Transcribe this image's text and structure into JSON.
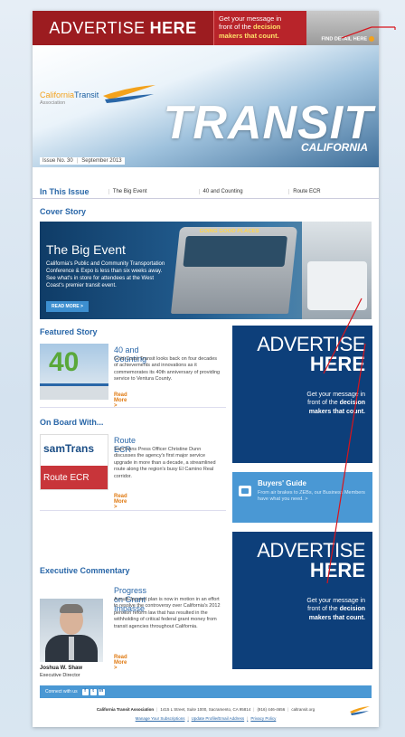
{
  "banner": {
    "advertise_word": "ADVERTISE",
    "here_word": "HERE",
    "line1": "Get your message in",
    "line2": "front of the",
    "line2_bold": "decision",
    "line3": "makers that count.",
    "find_label": "FIND DETAIL HERE"
  },
  "masthead": {
    "logo_part1": "California",
    "logo_part2": "Transit",
    "logo_assoc": "Association",
    "title": "TRANSIT",
    "subtitle": "CALIFORNIA",
    "issue": "Issue No. 30",
    "date": "September 2013"
  },
  "in_this_issue": {
    "label": "In This Issue",
    "items": [
      "The Big Event",
      "40 and Counting",
      "Route ECR"
    ]
  },
  "cover_story": {
    "heading": "Cover Story",
    "title": "The Big Event",
    "description": "California's Public and Community Transportation Conference & Expo is less than six weeks away. See what's in store for attendees at the West Coast's premier transit event.",
    "button": "READ MORE >",
    "bus_sign": "GOING GOOD PLACES"
  },
  "featured": {
    "heading": "Featured Story",
    "title": "40 and Counting",
    "text": "Gold Coast Transit looks back on four decades of achievements and innovations as it commemorates its 40th anniversary of providing service to Ventura County.",
    "more": "Read More >",
    "thumb_label": "40"
  },
  "onboard": {
    "heading": "On Board With...",
    "title": "Route ECR",
    "text": "SamTrans Press Officer Christine Dunn discusses the agency's first major service upgrade in more than a decade, a streamlined route along the region's busy El Camino Real corridor.",
    "more": "Read More >",
    "thumb_brand": "samTrans",
    "thumb_route": "Route ECR"
  },
  "executive": {
    "heading": "Executive Commentary",
    "title": "Progress on Grant Impasse",
    "text": "A multi-faceted plan is now in motion in an effort to resolve the controversy over California's 2012 pension reform law that has resulted in the withholding of critical federal grant money from transit agencies throughout California.",
    "more": "Read More >",
    "name": "Joshua W. Shaw",
    "role": "Executive Director"
  },
  "ad_box": {
    "line_a": "ADVERTISE",
    "line_b": "HERE",
    "msg1": "Get your message in",
    "msg2": "front of the",
    "msg2_bold": "decision",
    "msg3": "makers that count."
  },
  "buyers_guide": {
    "title": "Buyers' Guide",
    "text": "From air brakes to ZEBs, our Business Members have what you need. >"
  },
  "connect": {
    "label": "Connect with us",
    "icons": [
      "f",
      "t",
      "in"
    ]
  },
  "footer": {
    "org": "California Transit Association",
    "address": "1415 L Street, Suite 1000, Sacramento, CA 95814",
    "phone": "(916) 446-4656",
    "web": "caltransit.org",
    "link1": "Manage Your Subscriptions",
    "link2": "Update Profile/Email Address",
    "link3": "Privacy Policy"
  },
  "colors": {
    "banner_red": "#9c1c20",
    "heading_blue": "#2a67a8",
    "ad_navy": "#0d3f7a",
    "accent_orange": "#e07a12",
    "pointer_red": "#d8141c"
  }
}
